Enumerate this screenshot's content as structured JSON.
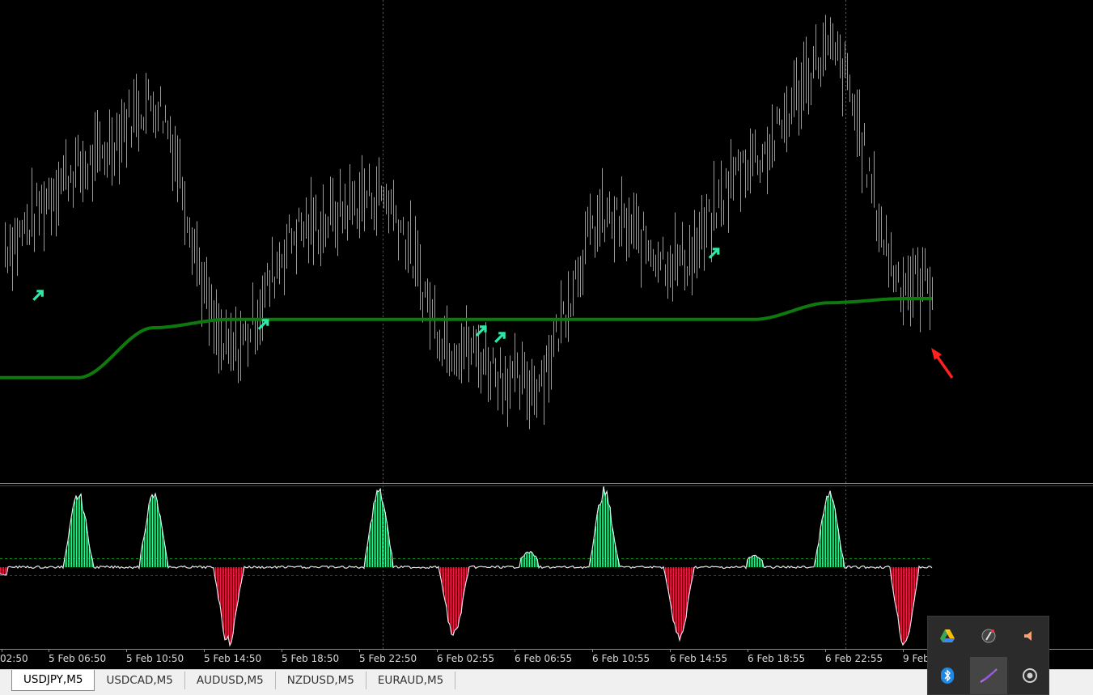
{
  "window": {
    "title": "USDJPY,M5"
  },
  "chart": {
    "background": "#000000",
    "price_color": "#9a9a9a",
    "ma_color": "#0e7a0e",
    "arrow_color": "#2ee8a4",
    "hist_up_color": "#37f29a",
    "hist_down_color": "#e8204e",
    "annotation_arrow_color": "#ff2020",
    "grid": "vertical dotted separators",
    "time_axis": [
      "02:50",
      "5 Feb 06:50",
      "5 Feb 10:50",
      "5 Feb 14:50",
      "5 Feb 18:50",
      "5 Feb 22:50",
      "6 Feb 02:55",
      "6 Feb 06:55",
      "6 Feb 10:55",
      "6 Feb 14:55",
      "6 Feb 18:55",
      "6 Feb 22:55",
      "9 Feb"
    ]
  },
  "chart_data": [
    {
      "type": "line",
      "title": "",
      "xlabel": "",
      "ylabel": "",
      "x": [
        "02:50",
        "5 Feb 06:50",
        "5 Feb 10:50",
        "5 Feb 14:50",
        "5 Feb 18:50",
        "5 Feb 22:50",
        "6 Feb 02:55",
        "6 Feb 06:55",
        "6 Feb 10:55",
        "6 Feb 14:55",
        "6 Feb 18:55",
        "6 Feb 22:55",
        "9 Feb"
      ],
      "series": [
        {
          "values": [
            54,
            72,
            88,
            28,
            58,
            66,
            30,
            20,
            60,
            50,
            75,
            100,
            45
          ]
        },
        {
          "values": [
            22,
            22,
            34,
            36,
            36,
            36,
            36,
            36,
            36,
            36,
            36,
            40,
            41
          ]
        }
      ],
      "ylim": [
        0,
        110
      ],
      "signal_arrows_x": [
        "02:50",
        "5 Feb 14:50",
        "6 Feb 02:55",
        "6 Feb 02:55",
        "6 Feb 14:55"
      ]
    },
    {
      "type": "bar",
      "title": "",
      "categories": [
        "02:50",
        "5 Feb 06:50",
        "5 Feb 10:50",
        "5 Feb 14:50",
        "5 Feb 18:50",
        "5 Feb 22:50",
        "6 Feb 02:55",
        "6 Feb 06:55",
        "6 Feb 10:55",
        "6 Feb 14:55",
        "6 Feb 18:55",
        "6 Feb 22:55",
        "9 Feb"
      ],
      "series": [
        {
          "values": [
            -10,
            95,
            95,
            -100,
            0,
            100,
            -90,
            20,
            100,
            -95,
            15,
            100,
            -100
          ]
        }
      ],
      "ylim": [
        -100,
        100
      ]
    }
  ],
  "tabs": [
    {
      "label": "USDJPY,M5",
      "active": true
    },
    {
      "label": "USDCAD,M5",
      "active": false
    },
    {
      "label": "AUDUSD,M5",
      "active": false
    },
    {
      "label": "NZDUSD,M5",
      "active": false
    },
    {
      "label": "EURAUD,M5",
      "active": false
    }
  ],
  "tray_icons": [
    {
      "name": "google-drive-icon",
      "color": "#34a853"
    },
    {
      "name": "pen-app-icon",
      "color": "#cccccc"
    },
    {
      "name": "speaker-icon",
      "color": "#f0a080"
    },
    {
      "name": "bluetooth-icon",
      "color": "#1e88e5"
    },
    {
      "name": "feather-icon",
      "color": "#b070e0"
    },
    {
      "name": "circle-app-icon",
      "color": "#cccccc"
    }
  ]
}
